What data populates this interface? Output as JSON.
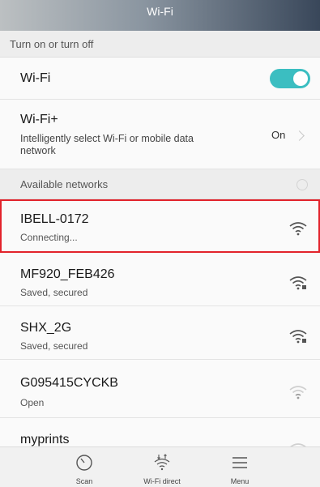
{
  "header": {
    "title": "Wi-Fi"
  },
  "section_toggle": {
    "label": "Turn on or turn off"
  },
  "wifi_row": {
    "label": "Wi-Fi",
    "enabled": true
  },
  "wifi_plus_row": {
    "title": "Wi-Fi+",
    "subtitle_line1": "Intelligently select Wi-Fi or mobile data",
    "subtitle_line2": "network",
    "status": "On"
  },
  "section_available": {
    "label": "Available networks"
  },
  "networks": [
    {
      "ssid": "IBELL-0172",
      "status": "Connecting...",
      "signal": "strong",
      "secured": false,
      "highlighted": true
    },
    {
      "ssid": "MF920_FEB426",
      "status": "Saved, secured",
      "signal": "strong",
      "secured": true
    },
    {
      "ssid": "SHX_2G",
      "status": "Saved, secured",
      "signal": "strong",
      "secured": true
    },
    {
      "ssid": "G095415CYCKB",
      "status": "Open",
      "signal": "weak",
      "secured": false
    },
    {
      "ssid": "myprints",
      "status": "",
      "signal": "weak",
      "secured": false
    }
  ],
  "bottom_bar": {
    "scan": "Scan",
    "wifi_direct": "Wi-Fi direct",
    "menu": "Menu"
  },
  "colors": {
    "toggle_on": "#3bbec1",
    "highlight_border": "#e2232b"
  }
}
